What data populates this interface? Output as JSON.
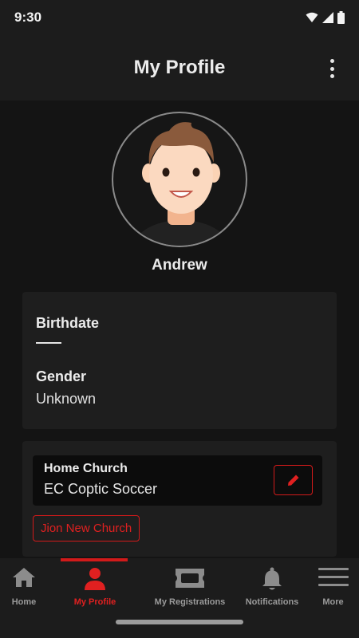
{
  "status_bar": {
    "time": "9:30"
  },
  "app_bar": {
    "title": "My Profile",
    "menu_icon": "more-vertical-icon"
  },
  "profile": {
    "name": "Andrew",
    "birthdate_label": "Birthdate",
    "birthdate_value": "",
    "gender_label": "Gender",
    "gender_value": "Unknown"
  },
  "church": {
    "label": "Home Church",
    "name": "EC Coptic Soccer",
    "join_label": "Jion New Church"
  },
  "nav": {
    "items": [
      {
        "label": "Home",
        "icon": "home-icon"
      },
      {
        "label": "My Profile",
        "icon": "person-icon",
        "active": true
      },
      {
        "label": "My Registrations",
        "icon": "ticket-icon"
      },
      {
        "label": "Notifications",
        "icon": "bell-icon"
      },
      {
        "label": "More",
        "icon": "hamburger-icon"
      }
    ]
  },
  "colors": {
    "accent": "#d11a1a",
    "background": "#141414",
    "surface": "#1e1e1e"
  }
}
